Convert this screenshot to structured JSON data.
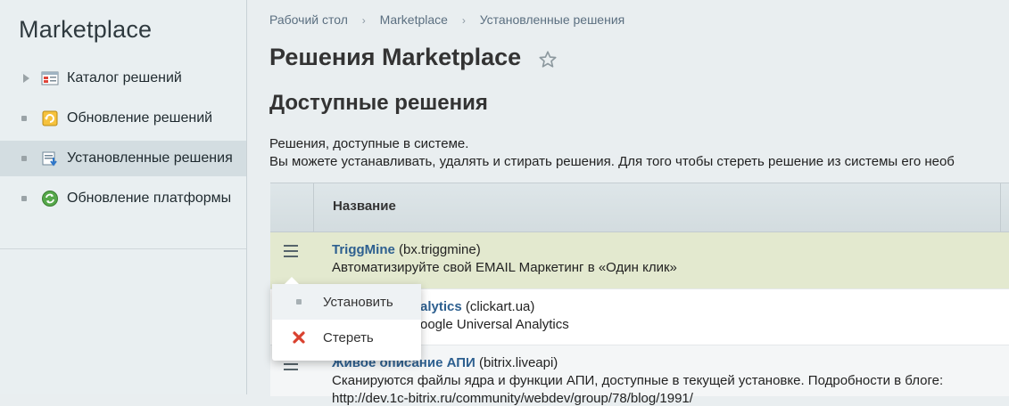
{
  "sidebar": {
    "title": "Marketplace",
    "items": [
      {
        "label": "Каталог решений",
        "icon": "catalog-icon",
        "marker": "arrow"
      },
      {
        "label": "Обновление решений",
        "icon": "update-solutions-icon",
        "marker": "dot"
      },
      {
        "label": "Установленные решения",
        "icon": "installed-solutions-icon",
        "marker": "dot",
        "active": true
      },
      {
        "label": "Обновление платформы",
        "icon": "platform-update-icon",
        "marker": "dot"
      }
    ]
  },
  "breadcrumb": [
    "Рабочий стол",
    "Marketplace",
    "Установленные решения"
  ],
  "page_title": "Решения Marketplace",
  "section_title": "Доступные решения",
  "description": {
    "line1": "Решения, доступные в системе.",
    "line2": "Вы можете устанавливать, удалять и стирать решения. Для того чтобы стереть решение из системы его необ"
  },
  "table": {
    "header_name": "Название",
    "rows": [
      {
        "name": "TriggMine",
        "code": " (bx.triggmine)",
        "desc": "Автоматизируйте свой EMAIL Маркетинг в «Один клик»"
      },
      {
        "name": "alytics",
        "code": " (clickart.ua)",
        "desc": "oogle Universal Analytics"
      },
      {
        "name": "Живое описание АПИ",
        "code": " (bitrix.liveapi)",
        "desc": "Сканируются файлы ядра и функции АПИ, доступные в текущей установке. Подробности в блоге:",
        "desc2": "http://dev.1c-bitrix.ru/community/webdev/group/78/blog/1991/"
      }
    ]
  },
  "popup": {
    "items": [
      {
        "label": "Установить",
        "icon": "dot"
      },
      {
        "label": "Стереть",
        "icon": "delete-x-icon"
      }
    ]
  },
  "colors": {
    "accent_link": "#2d5f8f",
    "highlight_row": "#e3e9cf",
    "sidebar_bg": "#e9eff1",
    "delete_red": "#d9412f"
  }
}
